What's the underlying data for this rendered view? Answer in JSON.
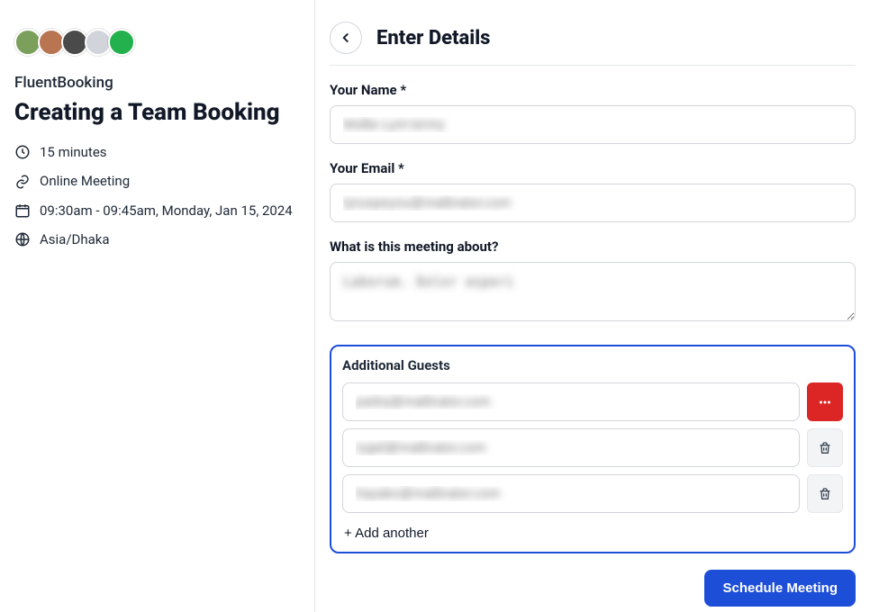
{
  "sidebar": {
    "org": "FluentBooking",
    "title": "Creating a Team Booking",
    "meta": {
      "duration": "15 minutes",
      "mode": "Online Meeting",
      "slot": "09:30am - 09:45am, Monday, Jan 15, 2024",
      "timezone": "Asia/Dhaka"
    },
    "avatar_colors": [
      "#7ba05b",
      "#b97452",
      "#4a4a4a",
      "#d1d5db",
      "#22b14c"
    ]
  },
  "form": {
    "header": "Enter Details",
    "name_label": "Your Name *",
    "name_value": "Mollie Lynt termy",
    "email_label": "Your Email *",
    "email_value": "tyruopeyou@mailinator.com",
    "about_label": "What is this meeting about?",
    "about_value": "Laborum. Dolor asperi",
    "guest_label": "Additional Guests",
    "guests": [
      "parka@mailinator.com",
      "rygel@mailinator.com",
      "hayako@mailinator.com"
    ],
    "add_another": "+ Add another",
    "submit": "Schedule Meeting"
  }
}
